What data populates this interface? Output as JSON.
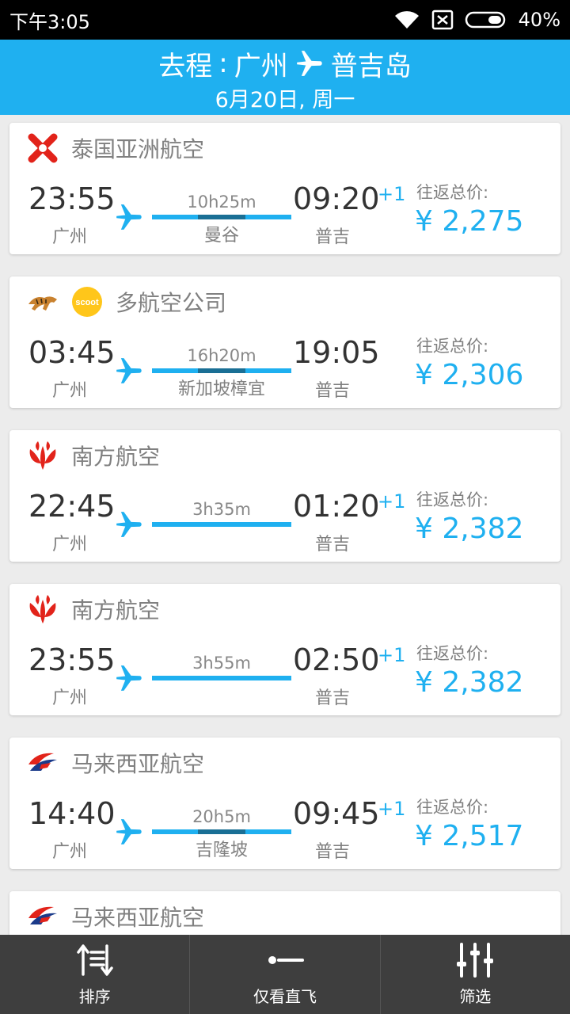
{
  "status_bar": {
    "time": "下午3:05",
    "battery": "40%"
  },
  "header": {
    "prefix": "去程",
    "separator": ":",
    "from": "广州",
    "to": "普吉岛",
    "date": "6月20日, 周一"
  },
  "flights": [
    {
      "airline": "泰国亚洲航空",
      "logos": [
        "airasia-logo"
      ],
      "dep_time": "23:55",
      "dep_city": "广州",
      "arr_time": "09:20",
      "next_day": "+1",
      "arr_city": "普吉",
      "duration": "10h25m",
      "stop": "曼谷",
      "price_label": "往返总价:",
      "price": "¥ 2,275"
    },
    {
      "airline": "多航空公司",
      "logos": [
        "tiger-logo",
        "scoot-logo"
      ],
      "dep_time": "03:45",
      "dep_city": "广州",
      "arr_time": "19:05",
      "next_day": "",
      "arr_city": "普吉",
      "duration": "16h20m",
      "stop": "新加坡樟宜",
      "price_label": "往返总价:",
      "price": "¥ 2,306"
    },
    {
      "airline": "南方航空",
      "logos": [
        "china-southern-logo"
      ],
      "dep_time": "22:45",
      "dep_city": "广州",
      "arr_time": "01:20",
      "next_day": "+1",
      "arr_city": "普吉",
      "duration": "3h35m",
      "stop": "",
      "price_label": "往返总价:",
      "price": "¥ 2,382"
    },
    {
      "airline": "南方航空",
      "logos": [
        "china-southern-logo"
      ],
      "dep_time": "23:55",
      "dep_city": "广州",
      "arr_time": "02:50",
      "next_day": "+1",
      "arr_city": "普吉",
      "duration": "3h55m",
      "stop": "",
      "price_label": "往返总价:",
      "price": "¥ 2,382"
    },
    {
      "airline": "马来西亚航空",
      "logos": [
        "malaysia-airlines-logo"
      ],
      "dep_time": "14:40",
      "dep_city": "广州",
      "arr_time": "09:45",
      "next_day": "+1",
      "arr_city": "普吉",
      "duration": "20h5m",
      "stop": "吉隆坡",
      "price_label": "往返总价:",
      "price": "¥ 2,517"
    },
    {
      "airline": "马来西亚航空",
      "logos": [
        "malaysia-airlines-logo"
      ]
    }
  ],
  "tabs": [
    {
      "label": "排序",
      "icon": "sort-icon"
    },
    {
      "label": "仅看直飞",
      "icon": "direct-flight-icon"
    },
    {
      "label": "筛选",
      "icon": "filter-icon"
    }
  ],
  "colors": {
    "accent": "#1fb0f0",
    "stopover": "#1a6f95",
    "tab_bar": "#3e3e3e"
  }
}
